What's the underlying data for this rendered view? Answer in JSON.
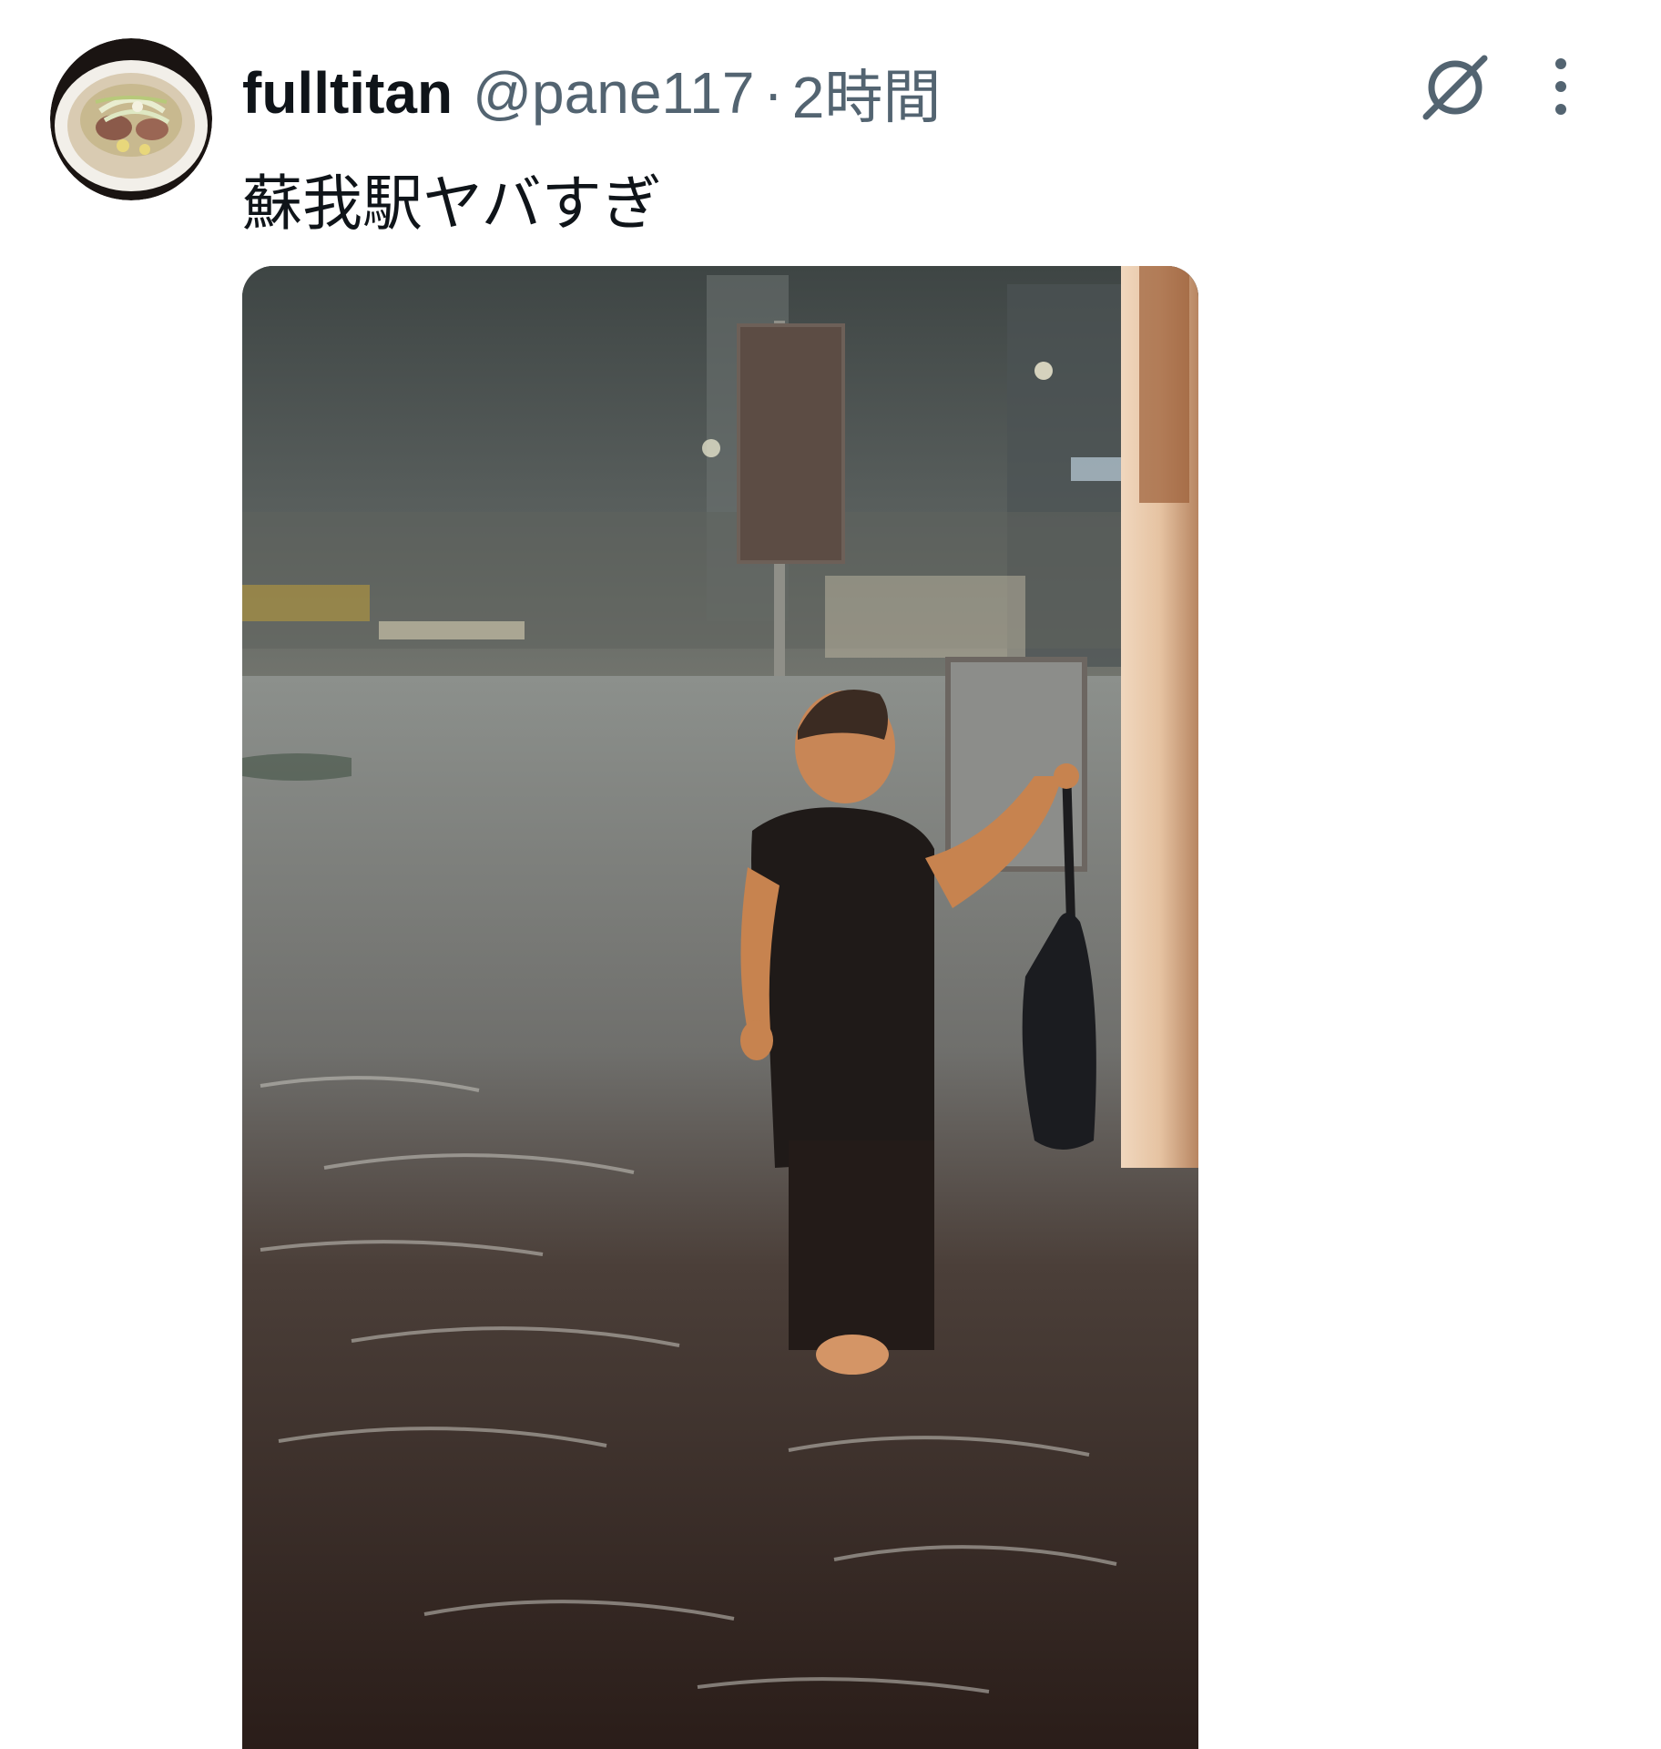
{
  "tweet": {
    "display_name": "fulltitan",
    "handle": "@pane117",
    "separator": "·",
    "time": "2時間",
    "text": "蘇我駅ヤバすぎ"
  },
  "icons": {
    "avatar": "ramen-bowl-avatar",
    "grok": "grok-icon",
    "more": "more-vertical-icon"
  },
  "colors": {
    "text_primary": "#0f1419",
    "text_secondary": "#536471"
  }
}
